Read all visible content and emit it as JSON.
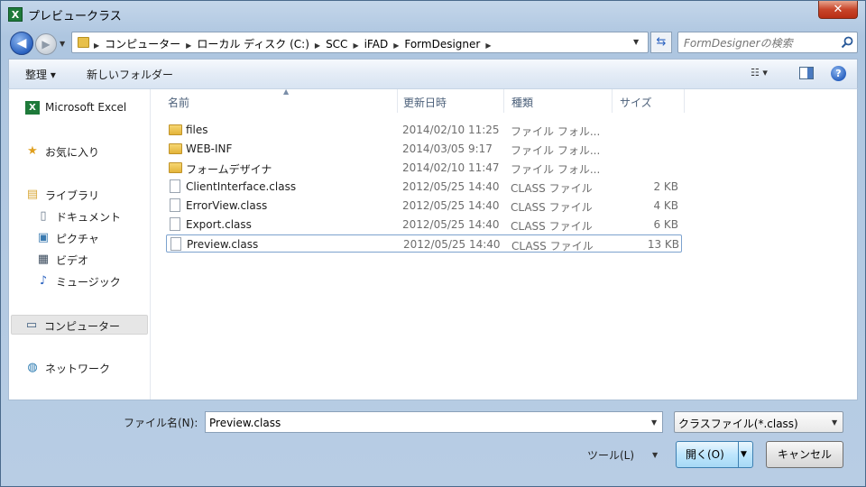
{
  "window": {
    "title": "プレビュークラス",
    "app_icon_letter": "X"
  },
  "nav": {
    "back_glyph": "◀",
    "forward_glyph": "▶",
    "breadcrumbs": [
      "コンピューター",
      "ローカル ディスク (C:)",
      "SCC",
      "iFAD",
      "FormDesigner"
    ],
    "search_placeholder": "FormDesignerの検索"
  },
  "toolbar": {
    "organize_label": "整理 ▾",
    "new_folder_label": "新しいフォルダー"
  },
  "sidebar": {
    "items": [
      {
        "label": "Microsoft Excel",
        "icon": "excel-icon"
      },
      {
        "label": "お気に入り",
        "icon": "star-icon"
      },
      {
        "label": "ライブラリ",
        "icon": "library-icon"
      },
      {
        "label": "ドキュメント",
        "icon": "document-icon"
      },
      {
        "label": "ピクチャ",
        "icon": "picture-icon"
      },
      {
        "label": "ビデオ",
        "icon": "video-icon"
      },
      {
        "label": "ミュージック",
        "icon": "music-icon"
      },
      {
        "label": "コンピューター",
        "icon": "computer-icon"
      },
      {
        "label": "ネットワーク",
        "icon": "network-icon"
      }
    ]
  },
  "filelist": {
    "columns": [
      "名前",
      "更新日時",
      "種類",
      "サイズ"
    ],
    "rows": [
      {
        "name": "files",
        "date": "2014/02/10 11:25",
        "type": "ファイル フォル...",
        "size": "",
        "kind": "folder"
      },
      {
        "name": "WEB-INF",
        "date": "2014/03/05 9:17",
        "type": "ファイル フォル...",
        "size": "",
        "kind": "folder"
      },
      {
        "name": "フォームデザイナ",
        "date": "2014/02/10 11:47",
        "type": "ファイル フォル...",
        "size": "",
        "kind": "folder"
      },
      {
        "name": "ClientInterface.class",
        "date": "2012/05/25 14:40",
        "type": "CLASS ファイル",
        "size": "2 KB",
        "kind": "file"
      },
      {
        "name": "ErrorView.class",
        "date": "2012/05/25 14:40",
        "type": "CLASS ファイル",
        "size": "4 KB",
        "kind": "file"
      },
      {
        "name": "Export.class",
        "date": "2012/05/25 14:40",
        "type": "CLASS ファイル",
        "size": "6 KB",
        "kind": "file"
      },
      {
        "name": "Preview.class",
        "date": "2012/05/25 14:40",
        "type": "CLASS ファイル",
        "size": "13 KB",
        "kind": "file",
        "selected": true
      }
    ]
  },
  "bottom": {
    "filename_label": "ファイル名(N):",
    "filename_value": "Preview.class",
    "filter_value": "クラスファイル(*.class)",
    "tools_label": "ツール(L)",
    "open_label": "開く(O)",
    "cancel_label": "キャンセル"
  }
}
